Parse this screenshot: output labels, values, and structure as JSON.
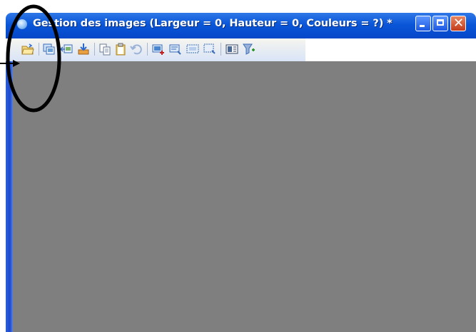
{
  "window": {
    "title": "Gestion des images  (Largeur = 0, Hauteur = 0, Couleurs = ?) *",
    "title_color": "#ffffff",
    "titlebar_color": "#0a56d8",
    "client_color": "#7f7f7f"
  },
  "controls": {
    "minimize_icon": "minimize-icon",
    "maximize_icon": "maximize-icon",
    "close_icon": "close-icon",
    "close_glyph": "✕"
  },
  "toolbar": {
    "icons": [
      "open-folder-icon",
      "duplicate-image-icon",
      "copy-image-icon",
      "import-icon",
      "copy-icon",
      "paste-icon",
      "undo-icon",
      "add-image-icon",
      "edit-image-icon",
      "select-area-icon",
      "select-region-icon",
      "properties-icon",
      "filter-icon"
    ]
  },
  "annotation": {
    "color": "#000000"
  }
}
